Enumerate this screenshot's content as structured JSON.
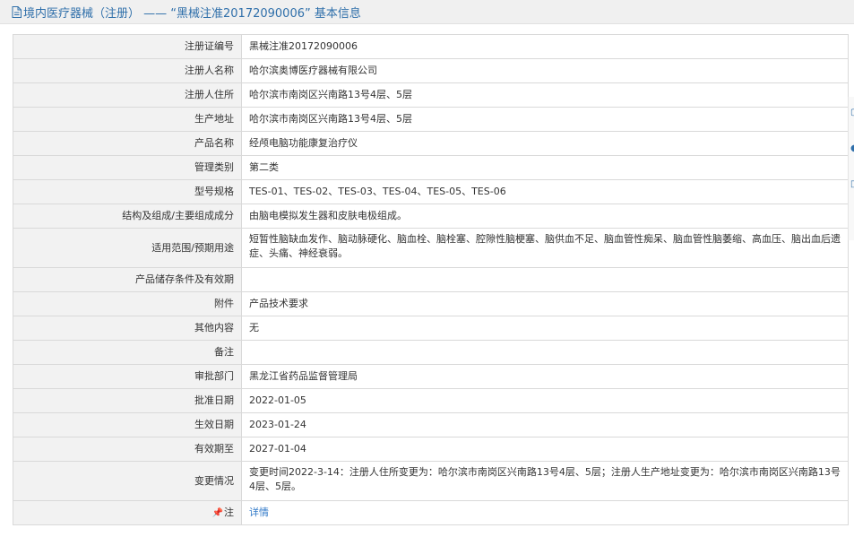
{
  "header": {
    "title": "境内医疗器械（注册） —— “黑械注准20172090006” 基本信息"
  },
  "rows": [
    {
      "label": "注册证编号",
      "value": "黑械注准20172090006"
    },
    {
      "label": "注册人名称",
      "value": "哈尔滨奥博医疗器械有限公司"
    },
    {
      "label": "注册人住所",
      "value": "哈尔滨市南岗区兴南路13号4层、5层"
    },
    {
      "label": "生产地址",
      "value": "哈尔滨市南岗区兴南路13号4层、5层"
    },
    {
      "label": "产品名称",
      "value": "经颅电脑功能康复治疗仪"
    },
    {
      "label": "管理类别",
      "value": "第二类"
    },
    {
      "label": "型号规格",
      "value": "TES-01、TES-02、TES-03、TES-04、TES-05、TES-06"
    },
    {
      "label": "结构及组成/主要组成成分",
      "value": "由脑电模拟发生器和皮肤电极组成。"
    },
    {
      "label": "适用范围/预期用途",
      "value": "短暂性脑缺血发作、脑动脉硬化、脑血栓、脑栓塞、腔隙性脑梗塞、脑供血不足、脑血管性痴呆、脑血管性脑萎缩、高血压、脑出血后遗症、头痛、神经衰弱。"
    },
    {
      "label": "产品储存条件及有效期",
      "value": ""
    },
    {
      "label": "附件",
      "value": "产品技术要求"
    },
    {
      "label": "其他内容",
      "value": "无"
    },
    {
      "label": "备注",
      "value": ""
    },
    {
      "label": "审批部门",
      "value": "黑龙江省药品监督管理局"
    },
    {
      "label": "批准日期",
      "value": "2022-01-05"
    },
    {
      "label": "生效日期",
      "value": "2023-01-24"
    },
    {
      "label": "有效期至",
      "value": "2027-01-04"
    },
    {
      "label": "变更情况",
      "value": "变更时间2022-3-14：注册人住所变更为：哈尔滨市南岗区兴南路13号4层、5层；注册人生产地址变更为：哈尔滨市南岗区兴南路13号4层、5层。"
    }
  ],
  "note": {
    "label": "注",
    "link": "详情"
  },
  "colors": {
    "title": "#2f6faa",
    "link": "#2f78c8",
    "label_bg": "#f2f2f2",
    "border": "#d9d9d9"
  }
}
